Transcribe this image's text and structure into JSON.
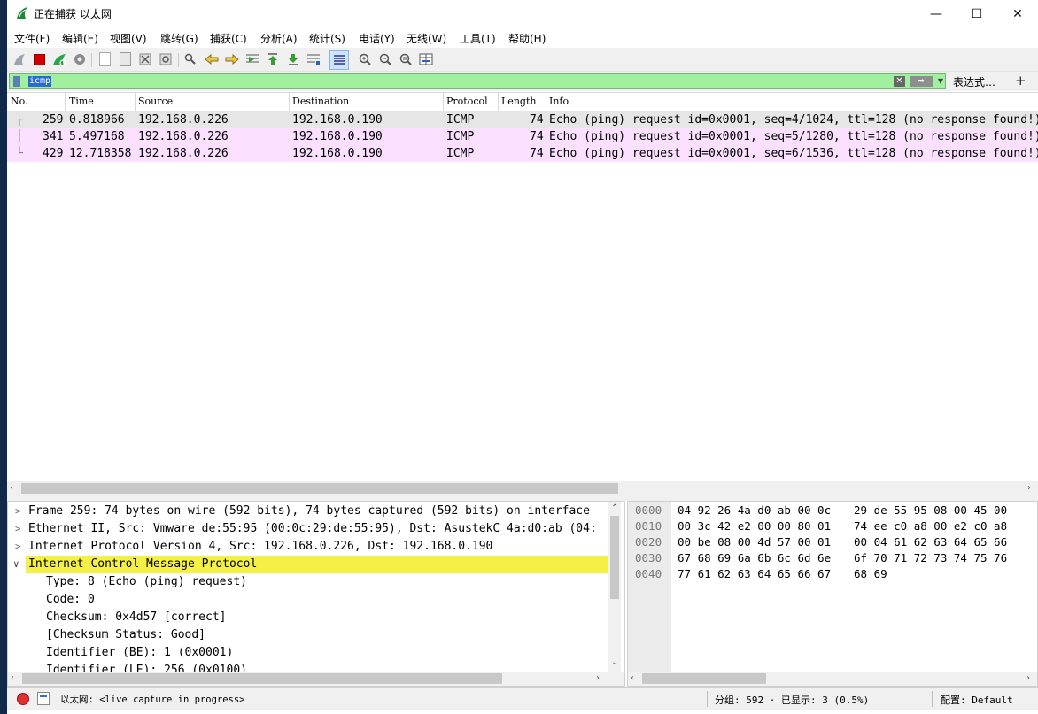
{
  "window": {
    "title": "正在捕获 以太网",
    "controls": {
      "minimize": "—",
      "maximize": "☐",
      "close": "✕"
    }
  },
  "menu": [
    "文件(F)",
    "编辑(E)",
    "视图(V)",
    "跳转(G)",
    "捕获(C)",
    "分析(A)",
    "统计(S)",
    "电话(Y)",
    "无线(W)",
    "工具(T)",
    "帮助(H)"
  ],
  "filter": {
    "value": "icmp",
    "expression_label": "表达式…",
    "add_label": "+"
  },
  "columns": [
    "No.",
    "Time",
    "Source",
    "Destination",
    "Protocol",
    "Length",
    "Info"
  ],
  "packets": [
    {
      "no": "259",
      "time": "0.818966",
      "source": "192.168.0.226",
      "destination": "192.168.0.190",
      "protocol": "ICMP",
      "length": "74",
      "info": "Echo (ping) request  id=0x0001, seq=4/1024, ttl=128 (no response found!)",
      "bg": "#e6e6e6"
    },
    {
      "no": "341",
      "time": "5.497168",
      "source": "192.168.0.226",
      "destination": "192.168.0.190",
      "protocol": "ICMP",
      "length": "74",
      "info": "Echo (ping) request  id=0x0001, seq=5/1280, ttl=128 (no response found!)",
      "bg": "#fce0ff"
    },
    {
      "no": "429",
      "time": "12.718358",
      "source": "192.168.0.226",
      "destination": "192.168.0.190",
      "protocol": "ICMP",
      "length": "74",
      "info": "Echo (ping) request  id=0x0001, seq=6/1536, ttl=128 (no response found!)",
      "bg": "#fce0ff"
    }
  ],
  "details": [
    {
      "arrow": ">",
      "text": "Frame 259: 74 bytes on wire (592 bits), 74 bytes captured (592 bits) on interface",
      "indent": 0,
      "highlight": false
    },
    {
      "arrow": ">",
      "text": "Ethernet II, Src: Vmware_de:55:95 (00:0c:29:de:55:95), Dst: AsustekC_4a:d0:ab (04:",
      "indent": 0,
      "highlight": false
    },
    {
      "arrow": ">",
      "text": "Internet Protocol Version 4, Src: 192.168.0.226, Dst: 192.168.0.190",
      "indent": 0,
      "highlight": false
    },
    {
      "arrow": "∨",
      "text": "Internet Control Message Protocol",
      "indent": 0,
      "highlight": true
    },
    {
      "arrow": "",
      "text": "Type: 8 (Echo (ping) request)",
      "indent": 1,
      "highlight": false
    },
    {
      "arrow": "",
      "text": "Code: 0",
      "indent": 1,
      "highlight": false
    },
    {
      "arrow": "",
      "text": "Checksum: 0x4d57 [correct]",
      "indent": 1,
      "highlight": false
    },
    {
      "arrow": "",
      "text": "[Checksum Status: Good]",
      "indent": 1,
      "highlight": false
    },
    {
      "arrow": "",
      "text": "Identifier (BE): 1 (0x0001)",
      "indent": 1,
      "highlight": false
    },
    {
      "arrow": "",
      "text": "Identifier (LE): 256 (0x0100)",
      "indent": 1,
      "highlight": false
    }
  ],
  "bytes": [
    {
      "offset": "0000",
      "hex1": "04 92 26 4a d0 ab 00 0c",
      "hex2": "29 de 55 95 08 00 45 00"
    },
    {
      "offset": "0010",
      "hex1": "00 3c 42 e2 00 00 80 01",
      "hex2": "74 ee c0 a8 00 e2 c0 a8"
    },
    {
      "offset": "0020",
      "hex1": "00 be 08 00 4d 57 00 01",
      "hex2": "00 04 61 62 63 64 65 66"
    },
    {
      "offset": "0030",
      "hex1": "67 68 69 6a 6b 6c 6d 6e",
      "hex2": "6f 70 71 72 73 74 75 76"
    },
    {
      "offset": "0040",
      "hex1": "77 61 62 63 64 65 66 67",
      "hex2": "68 69"
    }
  ],
  "status": {
    "interface_text": "以太网: <live capture in progress>",
    "packets_text": "分组: 592 · 已显示: 3 (0.5%)",
    "profile_text": "配置: Default"
  },
  "colors": {
    "filter_ok": "#a0f0a0",
    "highlight": "#f5f045",
    "icmp_row": "#fce0ff",
    "selected_row": "#e6e6e6"
  }
}
